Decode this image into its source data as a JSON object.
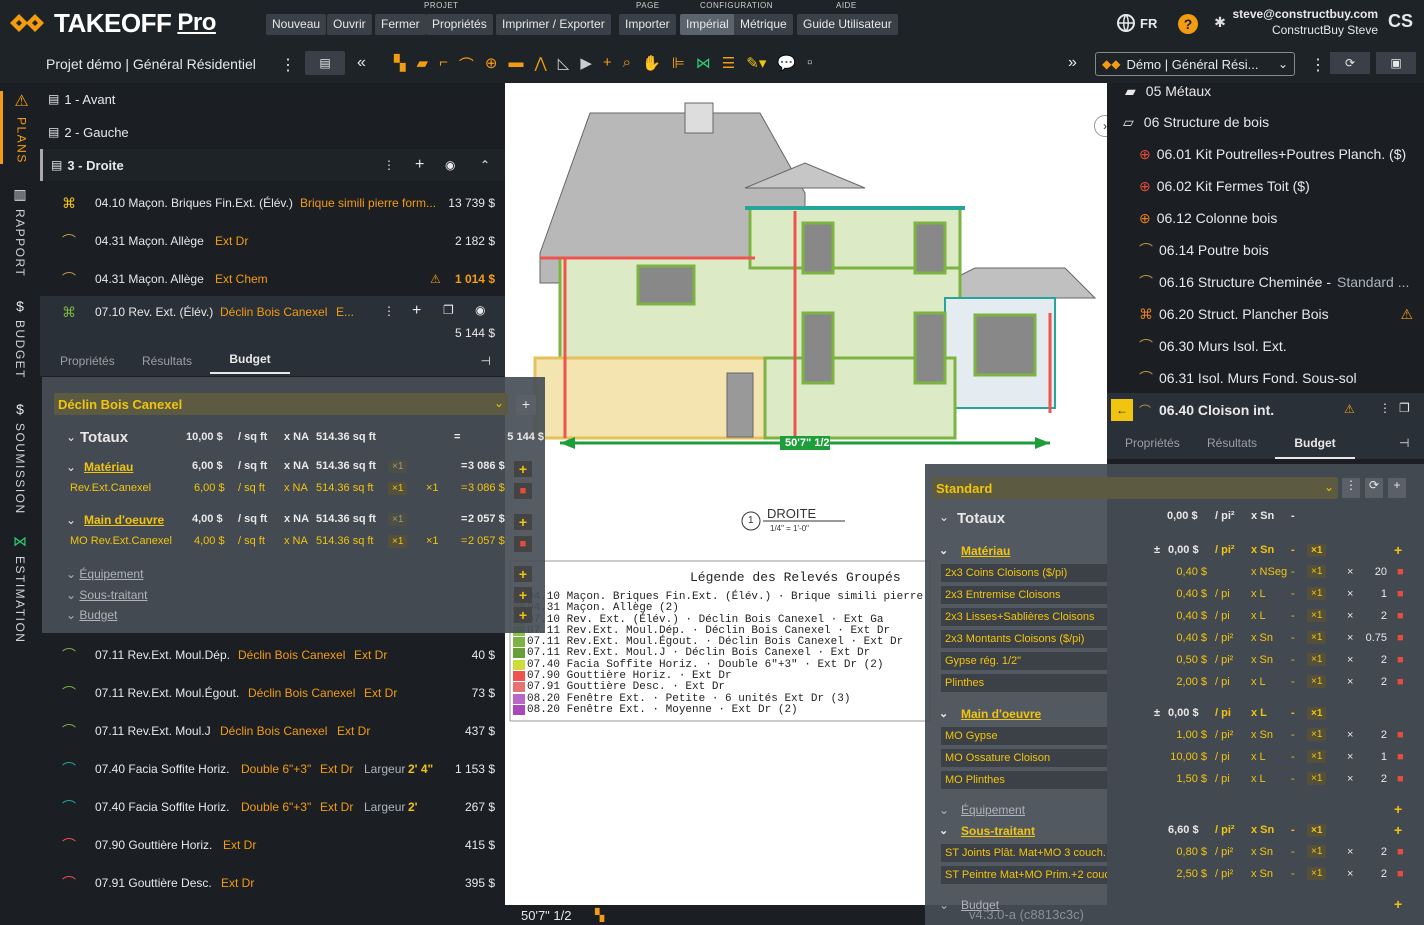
{
  "app": {
    "brand": "TAKEOFF",
    "brand_suffix": "Pro",
    "lang": "FR",
    "user_email": "steve@constructbuy.com",
    "user_name": "ConstructBuy Steve",
    "user_initials": "CS"
  },
  "menu": {
    "group_projet": "PROJET",
    "group_page": "PAGE",
    "group_config": "CONFIGURATION",
    "group_aide": "AIDE",
    "nouveau": "Nouveau",
    "ouvrir": "Ouvrir",
    "fermer": "Fermer",
    "proprietes": "Propriétés",
    "imprimer": "Imprimer / Exporter",
    "importer": "Importer",
    "imperial": "Impérial",
    "metrique": "Métrique",
    "guide": "Guide Utilisateur"
  },
  "project": {
    "title": "Projet démo | Général Résidentiel",
    "selector": "Démo | Général Rési..."
  },
  "rail": {
    "plans": "PLANS",
    "rapport": "RAPPORT",
    "budget": "BUDGET",
    "soumission": "SOUMISSION",
    "estimation": "ESTIMATION"
  },
  "pages": [
    {
      "label": "1 - Avant"
    },
    {
      "label": "2 - Gauche"
    },
    {
      "label": "3 - Droite"
    }
  ],
  "items_top": [
    {
      "name": "04.10 Maçon. Briques Fin.Ext. (Élév.)",
      "detail": "Brique simili pierre form...",
      "amount": "13 739 $"
    },
    {
      "name": "04.31 Maçon. Allège",
      "detail": "Ext Dr",
      "amount": "2 182 $"
    },
    {
      "name": "04.31 Maçon. Allège",
      "detail": "Ext Chem",
      "amount": "1 014 $"
    },
    {
      "name": "07.10 Rev. Ext. (Élév.)",
      "detail": "Déclin Bois Canexel",
      "detail2": "E...",
      "amount": "5 144 $"
    }
  ],
  "left_tabs": {
    "proprietes": "Propriétés",
    "resultats": "Résultats",
    "budget": "Budget"
  },
  "left_budget": {
    "name": "Déclin Bois Canexel",
    "totaux": {
      "label": "Totaux",
      "price": "10,00 $",
      "unit": "/ sq ft",
      "qtylabel": "x NA",
      "qty": "514.36 sq ft",
      "eq": "=",
      "total": "5 144 $"
    },
    "materiau": {
      "label": "Matériau",
      "price": "6,00 $",
      "unit": "/ sq ft",
      "qtylabel": "x NA",
      "qty": "514.36 sq ft",
      "mult": "×1",
      "eq": "=",
      "total": "3 086 $",
      "item": {
        "name": "Rev.Ext.Canexel",
        "price": "6,00 $",
        "unit": "/ sq ft",
        "qtylabel": "x NA",
        "qty": "514.36 sq ft",
        "mult": "×1",
        "mult2": "×1",
        "eq": "=",
        "total": "3 086 $"
      }
    },
    "main": {
      "label": "Main d'oeuvre",
      "price": "4,00 $",
      "unit": "/ sq ft",
      "qtylabel": "x NA",
      "qty": "514.36 sq ft",
      "mult": "×1",
      "eq": "=",
      "total": "2 057 $",
      "item": {
        "name": "MO Rev.Ext.Canexel",
        "price": "4,00 $",
        "unit": "/ sq ft",
        "qtylabel": "x NA",
        "qty": "514.36 sq ft",
        "mult": "×1",
        "mult2": "×1",
        "eq": "=",
        "total": "2 057 $"
      }
    },
    "equipement": "Équipement",
    "soustraitant": "Sous-traitant",
    "budget": "Budget"
  },
  "items_bottom": [
    {
      "name": "07.11 Rev.Ext. Moul.Dép.",
      "detail": "Déclin Bois Canexel",
      "detail2": "Ext Dr",
      "amount": "40 $"
    },
    {
      "name": "07.11 Rev.Ext. Moul.Égout.",
      "detail": "Déclin Bois Canexel",
      "detail2": "Ext Dr",
      "amount": "73 $"
    },
    {
      "name": "07.11 Rev.Ext. Moul.J",
      "detail": "Déclin Bois Canexel",
      "detail2": "Ext Dr",
      "amount": "437 $"
    },
    {
      "name": "07.40 Facia Soffite Horiz.",
      "detail": "Double 6\"+3\"",
      "detail2": "Ext Dr",
      "extra": "Largeur",
      "extraval": "2' 4\"",
      "amount": "1 153 $"
    },
    {
      "name": "07.40 Facia Soffite Horiz.",
      "detail": "Double 6\"+3\"",
      "detail2": "Ext Dr",
      "extra": "Largeur",
      "extraval": "2'",
      "amount": "267 $"
    },
    {
      "name": "07.90 Gouttière Horiz.",
      "detail": "Ext Dr",
      "amount": "415 $"
    },
    {
      "name": "07.91 Gouttière Desc.",
      "detail": "Ext Dr",
      "amount": "395 $"
    }
  ],
  "drawing": {
    "dimension": "50'7\" 1/2",
    "view_num": "1",
    "view_title": "DROITE",
    "view_scale": "1/4\" = 1'-0\"",
    "legend_title": "Légende des Relevés Groupés",
    "legend": [
      "04.10 Maçon. Briques Fin.Ext. (Élév.) · Brique simili pierre",
      "04.31 Maçon. Allège (2)",
      "07.10 Rev. Ext. (Élév.) · Déclin Bois Canexel · Ext Ga",
      "07.11 Rev.Ext. Moul.Dép. · Déclin Bois Canexel · Ext Dr",
      "07.11 Rev.Ext. Moul.Égout. · Déclin Bois Canexel · Ext Dr",
      "07.11 Rev.Ext. Moul.J · Déclin Bois Canexel · Ext Dr",
      "07.40 Facia Soffite Horiz. · Double 6\"+3\" · Ext Dr (2)",
      "07.90 Gouttière Horiz. · Ext Dr",
      "07.91 Gouttière Desc. · Ext Dr",
      "08.20 Fenêtre Ext. · Petite · 6 unités Ext Dr (3)",
      "08.20 Fenêtre Ext. · Moyenne · Ext Dr (2)"
    ],
    "legend_colors": [
      "#e4c15a",
      "#c9b27a",
      "#9ccc65",
      "#8bc34a",
      "#7cb342",
      "#689f38",
      "#cddc39",
      "#ef5350",
      "#e57373",
      "#ba68c8",
      "#ab47bc"
    ],
    "status_dim": "50'7\" 1/2"
  },
  "right_tree": [
    {
      "label": "05 Métaux"
    },
    {
      "label": "06 Structure de bois"
    },
    {
      "label": "06.01 Kit Poutrelles+Poutres Planch. ($)"
    },
    {
      "label": "06.02 Kit Fermes Toit ($)"
    },
    {
      "label": "06.12 Colonne bois"
    },
    {
      "label": "06.14 Poutre bois"
    },
    {
      "label": "06.16 Structure Cheminée -",
      "detail": "Standard ..."
    },
    {
      "label": "06.20 Struct. Plancher Bois"
    },
    {
      "label": "06.30 Murs Isol. Ext."
    },
    {
      "label": "06.31 Isol. Murs Fond. Sous-sol"
    },
    {
      "label": "06.40 Cloison int."
    }
  ],
  "right_tabs": {
    "proprietes": "Propriétés",
    "resultats": "Résultats",
    "budget": "Budget"
  },
  "right_budget": {
    "name": "Standard",
    "totaux": {
      "label": "Totaux",
      "price": "0,00 $",
      "unit": "/ pi²",
      "qty": "x Sn",
      "dash": "-"
    },
    "materiau": {
      "label": "Matériau",
      "pm": "±",
      "price": "0,00 $",
      "unit": "/ pi²",
      "qty": "x Sn",
      "dash": "-",
      "mult": "×1"
    },
    "mat_items": [
      {
        "name": "2x3 Coins Cloisons ($/pi)",
        "price": "0,40 $",
        "unit": "",
        "qty": "x NSeg",
        "dash": "-",
        "mult": "×1",
        "x": "×",
        "n": "20"
      },
      {
        "name": "2x3 Entremise Cloisons",
        "price": "0,40 $",
        "unit": "/ pi",
        "qty": "x L",
        "dash": "-",
        "mult": "×1",
        "x": "×",
        "n": "1"
      },
      {
        "name": "2x3 Lisses+Sablières Cloisons",
        "price": "0,40 $",
        "unit": "/ pi",
        "qty": "x L",
        "dash": "-",
        "mult": "×1",
        "x": "×",
        "n": "2"
      },
      {
        "name": "2x3 Montants Cloisons ($/pi)",
        "price": "0,40 $",
        "unit": "/ pi²",
        "qty": "x Sn",
        "dash": "-",
        "mult": "×1",
        "x": "×",
        "n": "0.75"
      },
      {
        "name": "Gypse rég. 1/2\"",
        "price": "0,50 $",
        "unit": "/ pi²",
        "qty": "x Sn",
        "dash": "-",
        "mult": "×1",
        "x": "×",
        "n": "2"
      },
      {
        "name": "Plinthes",
        "price": "2,00 $",
        "unit": "/ pi",
        "qty": "x L",
        "dash": "-",
        "mult": "×1",
        "x": "×",
        "n": "2"
      }
    ],
    "main": {
      "label": "Main d'oeuvre",
      "pm": "±",
      "price": "0,00 $",
      "unit": "/ pi",
      "qty": "x L",
      "dash": "-",
      "mult": "×1"
    },
    "main_items": [
      {
        "name": "MO Gypse",
        "price": "1,00 $",
        "unit": "/ pi²",
        "qty": "x Sn",
        "dash": "-",
        "mult": "×1",
        "x": "×",
        "n": "2"
      },
      {
        "name": "MO Ossature Cloison",
        "price": "10,00 $",
        "unit": "/ pi",
        "qty": "x L",
        "dash": "-",
        "mult": "×1",
        "x": "×",
        "n": "1"
      },
      {
        "name": "MO Plinthes",
        "price": "1,50 $",
        "unit": "/ pi",
        "qty": "x L",
        "dash": "-",
        "mult": "×1",
        "x": "×",
        "n": "2"
      }
    ],
    "equipement": "Équipement",
    "st": {
      "label": "Sous-traitant",
      "price": "6,60 $",
      "unit": "/ pi²",
      "qty": "x Sn",
      "dash": "-",
      "mult": "×1"
    },
    "st_items": [
      {
        "name": "ST Joints Plât. Mat+MO 3 couch.",
        "price": "0,80 $",
        "unit": "/ pi²",
        "qty": "x Sn",
        "dash": "-",
        "mult": "×1",
        "x": "×",
        "n": "2"
      },
      {
        "name": "ST Peintre Mat+MO Prim.+2 couch.fin.",
        "price": "2,50 $",
        "unit": "/ pi²",
        "qty": "x Sn",
        "dash": "-",
        "mult": "×1",
        "x": "×",
        "n": "2"
      }
    ],
    "budget": "Budget",
    "version": "v4.3.0-a (c8813c3c)"
  }
}
